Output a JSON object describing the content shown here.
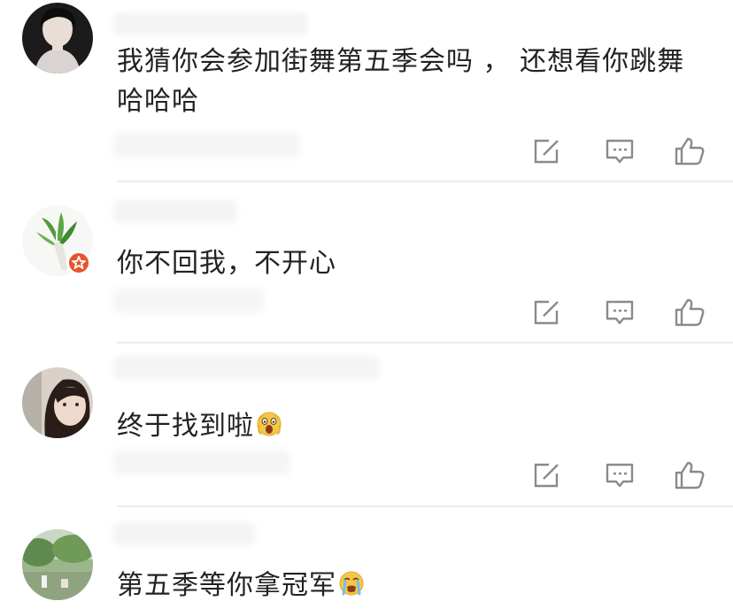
{
  "comments": [
    {
      "text": "我猜你会参加街舞第五季会吗 ， 还想看你跳舞哈哈哈",
      "avatar_icon": "avatar-woman-portrait",
      "emoji": ""
    },
    {
      "text": "你不回我，不开心",
      "avatar_icon": "avatar-radish",
      "emoji": "",
      "verified_badge": "verified-badge-icon"
    },
    {
      "text": "终于找到啦",
      "avatar_icon": "avatar-girl-portrait",
      "emoji": "shocked-emoji"
    },
    {
      "text": "第五季等你拿冠军",
      "avatar_icon": "avatar-outdoor-scene",
      "emoji": "crying-emoji"
    }
  ],
  "actions": {
    "icons": [
      "share-icon",
      "comment-icon",
      "like-icon"
    ]
  },
  "colors": {
    "text": "#222222",
    "icon": "#8a8a8a",
    "divider": "#ececec",
    "badge": "#e8532b"
  }
}
